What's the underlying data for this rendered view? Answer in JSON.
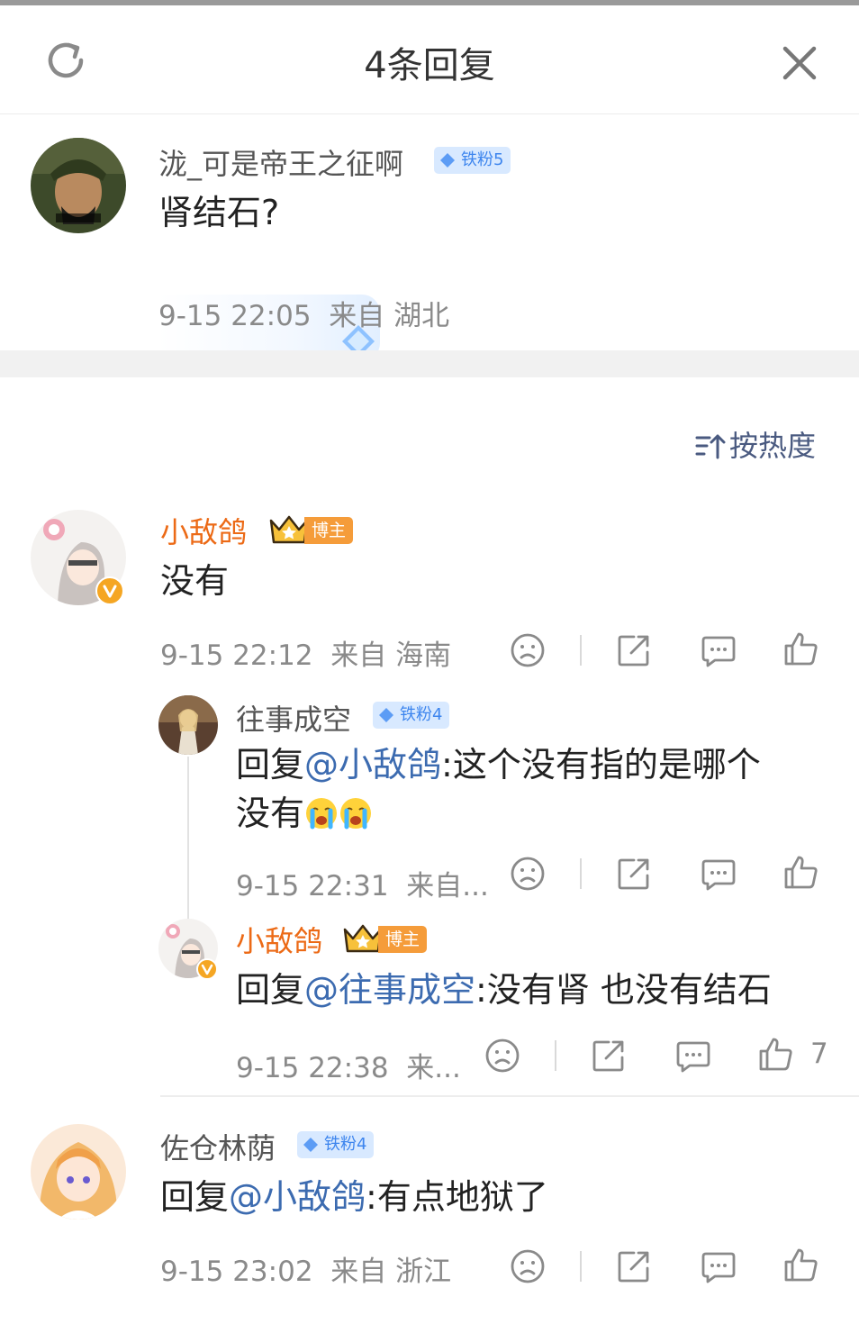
{
  "header": {
    "title": "4条回复",
    "refresh_icon": "refresh-icon",
    "close_icon": "close-icon"
  },
  "root_comment": {
    "username": "泷_可是帝王之征啊",
    "badge": "铁粉5",
    "text": "肾结石?",
    "time": "9-15 22:05",
    "location": "来自 湖北"
  },
  "sort": {
    "label": "按热度",
    "icon": "sort-icon"
  },
  "replies": [
    {
      "username": "小敌鸽",
      "badge": "博主",
      "text": "没有",
      "time": "9-15 22:12",
      "location": "来自 海南",
      "sub_replies": [
        {
          "username": "往事成空",
          "badge": "铁粉4",
          "text_prefix": "回复",
          "mention": "@小敌鸽",
          "text_line1": ":这个没有指的是哪个",
          "text_line2": "没有",
          "emoji": "crying-emoji",
          "time": "9-15 22:31",
          "location": "来自..."
        },
        {
          "username": "小敌鸽",
          "badge": "博主",
          "text_prefix": "回复",
          "mention": "@往事成空",
          "text": ":没有肾 也没有结石",
          "time": "9-15 22:38",
          "location": "来...",
          "likes": "7"
        }
      ]
    },
    {
      "username": "佐仓林荫",
      "badge": "铁粉4",
      "text_prefix": "回复",
      "mention": "@小敌鸽",
      "text": ":有点地狱了",
      "time": "9-15 23:02",
      "location": "来自 浙江"
    }
  ],
  "colors": {
    "host_name": "#ec6a16",
    "mention": "#3c6bb0",
    "fan_badge_bg": "#d8e9ff",
    "host_badge_bg": "#f59c3a"
  }
}
